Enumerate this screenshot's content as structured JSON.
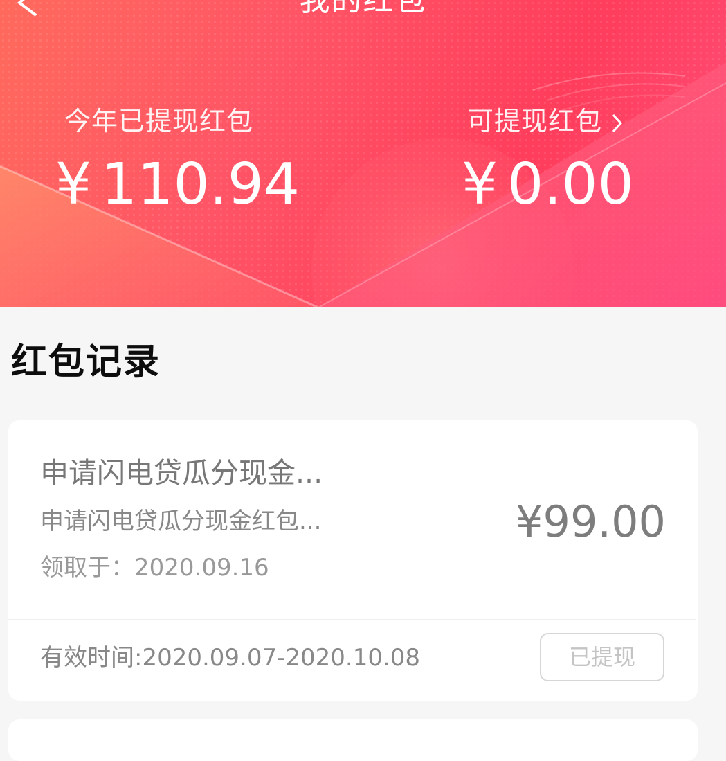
{
  "header": {
    "title": "我的红包",
    "back_icon": "chevron-left-icon",
    "more_icon": "more-dots-icon"
  },
  "stats": {
    "withdrawn_label": "今年已提现红包",
    "withdrawn_value": "110.94",
    "available_label": "可提现红包",
    "available_value": "0.00",
    "currency": "¥"
  },
  "records": {
    "title": "红包记录",
    "items": [
      {
        "name": "申请闪电贷瓜分现金...",
        "desc": "申请闪电贷瓜分现金红包...",
        "received": "领取于：2020.09.16",
        "amount": "99.00",
        "valid": "有效时间:2020.09.07-2020.10.08",
        "status": "已提现"
      }
    ]
  },
  "colors": {
    "banner_start": "#ff6a5c",
    "banner_end": "#ff4f7a",
    "page_bg": "#f6f6f6"
  }
}
